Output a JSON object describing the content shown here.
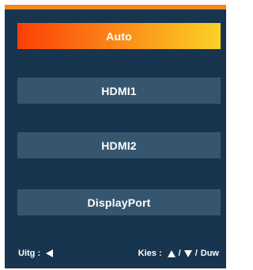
{
  "colors": {
    "panel_background": "#17354f",
    "top_accent": "#f2881e",
    "item_background": "#36566f",
    "selected_gradient_start": "#fb3f06",
    "selected_gradient_end": "#fbd225",
    "text": "#ffffff"
  },
  "menu": {
    "selected_index": 0,
    "items": [
      {
        "label": "Auto"
      },
      {
        "label": "HDMI1"
      },
      {
        "label": "HDMI2"
      },
      {
        "label": "DisplayPort"
      }
    ]
  },
  "footer": {
    "back_label": "Uitg :",
    "back_icon": "left-triangle-icon",
    "select_label": "Kies :",
    "up_icon": "up-triangle-icon",
    "down_icon": "down-triangle-icon",
    "separator": "/",
    "confirm_label": "Duw"
  }
}
